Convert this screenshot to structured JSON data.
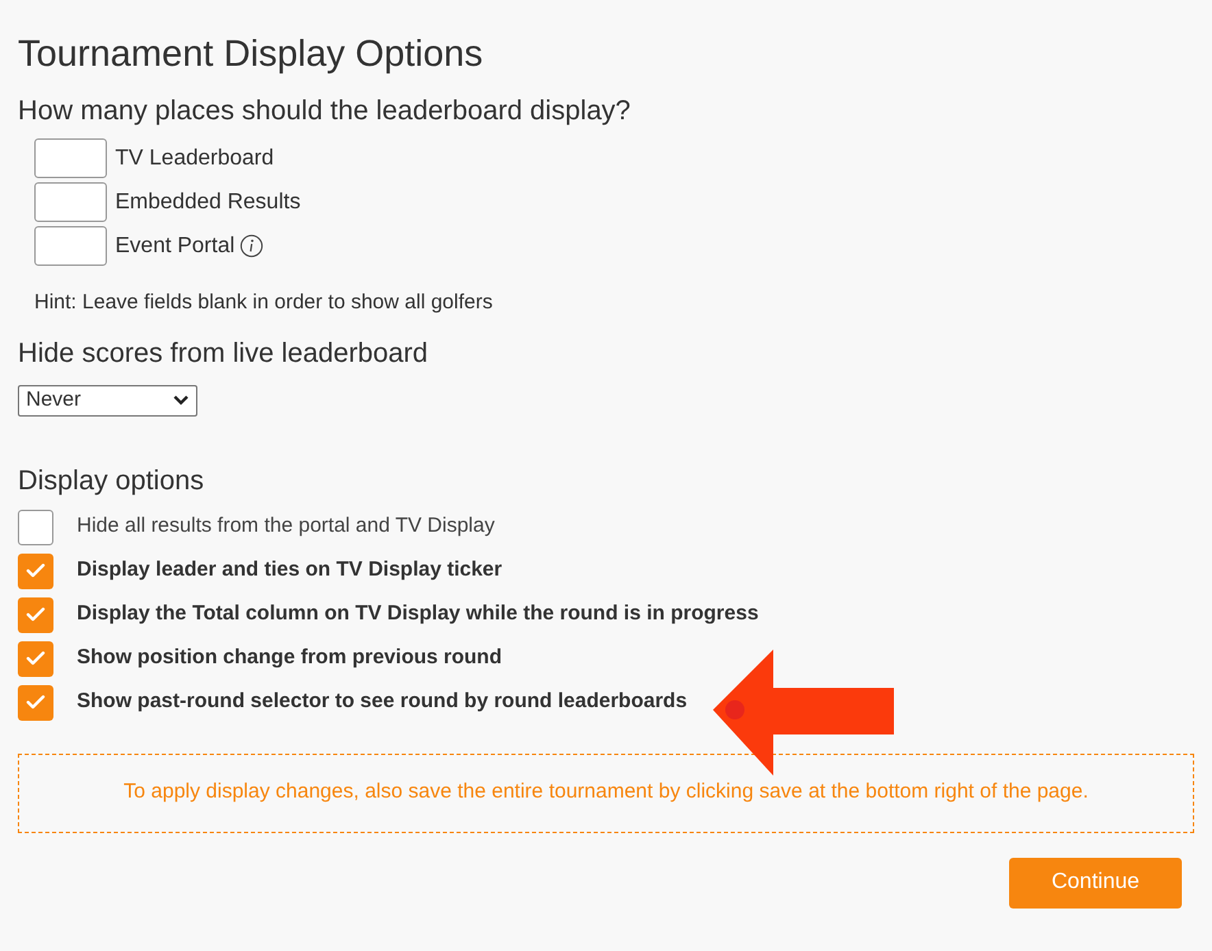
{
  "title": "Tournament Display Options",
  "places": {
    "heading": "How many places should the leaderboard display?",
    "fields": [
      {
        "label": "TV Leaderboard",
        "info": false
      },
      {
        "label": "Embedded Results",
        "info": false
      },
      {
        "label": "Event Portal",
        "info": true
      }
    ],
    "hint": "Hint: Leave fields blank in order to show all golfers"
  },
  "hide_scores": {
    "heading": "Hide scores from live leaderboard",
    "value": "Never"
  },
  "display_options": {
    "heading": "Display options",
    "items": [
      {
        "label": "Hide all results from the portal and TV Display",
        "checked": false
      },
      {
        "label": "Display leader and ties on TV Display ticker",
        "checked": true
      },
      {
        "label": "Display the Total column on TV Display while the round is in progress",
        "checked": true
      },
      {
        "label": "Show position change from previous round",
        "checked": true
      },
      {
        "label": "Show past-round selector to see round by round leaderboards",
        "checked": true
      }
    ]
  },
  "notice": "To apply display changes, also save the entire tournament by clicking save at the bottom right of the page.",
  "continue_button": "Continue"
}
